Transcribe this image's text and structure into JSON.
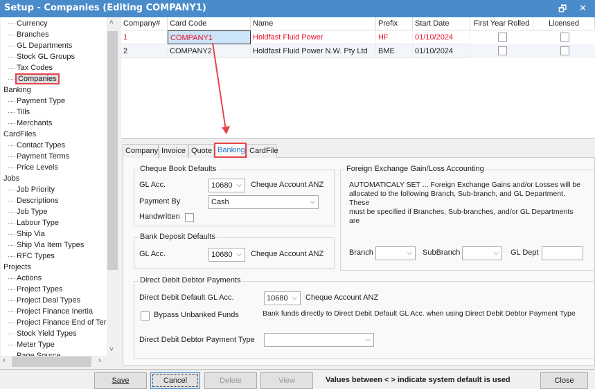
{
  "window": {
    "title": "Setup - Companies (Editing COMPANY1)",
    "restore_icon": "restore-icon",
    "close_icon": "close-icon"
  },
  "tree": [
    {
      "label": "Currency",
      "level": 1
    },
    {
      "label": "Branches",
      "level": 1
    },
    {
      "label": "GL Departments",
      "level": 1
    },
    {
      "label": "Stock GL Groups",
      "level": 1
    },
    {
      "label": "Tax Codes",
      "level": 1
    },
    {
      "label": "Companies",
      "level": 1,
      "selected": true
    },
    {
      "label": "Banking",
      "level": 0
    },
    {
      "label": "Payment Type",
      "level": 1
    },
    {
      "label": "Tills",
      "level": 1
    },
    {
      "label": "Merchants",
      "level": 1
    },
    {
      "label": "CardFiles",
      "level": 0
    },
    {
      "label": "Contact Types",
      "level": 1
    },
    {
      "label": "Payment Terms",
      "level": 1
    },
    {
      "label": "Price Levels",
      "level": 1
    },
    {
      "label": "Jobs",
      "level": 0
    },
    {
      "label": "Job Priority",
      "level": 1
    },
    {
      "label": "Descriptions",
      "level": 1
    },
    {
      "label": "Job Type",
      "level": 1
    },
    {
      "label": "Labour Type",
      "level": 1
    },
    {
      "label": "Ship Via",
      "level": 1
    },
    {
      "label": "Ship Via Item Types",
      "level": 1
    },
    {
      "label": "RFC Types",
      "level": 1
    },
    {
      "label": "Projects",
      "level": 0
    },
    {
      "label": "Actions",
      "level": 1
    },
    {
      "label": "Project Types",
      "level": 1
    },
    {
      "label": "Project Deal Types",
      "level": 1
    },
    {
      "label": "Project Finance Inertia",
      "level": 1
    },
    {
      "label": "Project Finance End of Term",
      "level": 1
    },
    {
      "label": "Stock Yield Types",
      "level": 1
    },
    {
      "label": "Meter Type",
      "level": 1
    },
    {
      "label": "Page Source",
      "level": 1
    }
  ],
  "grid": {
    "columns": [
      "Company#",
      "Card Code",
      "Name",
      "Prefix",
      "Start Date",
      "First Year Rolled",
      "Licensed"
    ],
    "rows": [
      {
        "num": "1",
        "code": "COMPANY1",
        "name": "Holdfast Fluid Power",
        "prefix": "HF",
        "start": "01/10/2024",
        "first_year_rolled": false,
        "licensed": false,
        "highlight": true
      },
      {
        "num": "2",
        "code": "COMPANY2",
        "name": "Holdfast Fluid Power N.W. Pty Ltd",
        "prefix": "BME",
        "start": "01/10/2024",
        "first_year_rolled": false,
        "licensed": false
      }
    ]
  },
  "tabs": [
    "Company",
    "Invoice",
    "Quote",
    "Banking",
    "CardFile"
  ],
  "active_tab": "Banking",
  "banking": {
    "cheque": {
      "title": "Cheque Book Defaults",
      "gl_label": "GL Acc.",
      "gl_value": "10680",
      "gl_desc": "Cheque Account ANZ",
      "payment_label": "Payment By",
      "payment_value": "Cash",
      "handwritten_label": "Handwritten",
      "handwritten": false
    },
    "deposit": {
      "title": "Bank Deposit Defaults",
      "gl_label": "GL Acc.",
      "gl_value": "10680",
      "gl_desc": "Cheque Account ANZ"
    },
    "fx": {
      "title": "Foreign Exchange Gain/Loss Accounting",
      "text1": "AUTOMATICALY SET ... Foreign Exchange Gains and/or Losses will be",
      "text2": "allocated to the following Branch, Sub-branch, and GL Department.  These",
      "text3": "must be specified if Branches, Sub-branches, and/or GL Departments are",
      "branch_label": "Branch",
      "subbranch_label": "SubBranch",
      "gldept_label": "GL Dept"
    },
    "dd": {
      "title": "Direct Debit Debtor Payments",
      "gl_label": "Direct Debit Default GL Acc.",
      "gl_value": "10680",
      "gl_desc": "Cheque Account ANZ",
      "bypass_label": "Bypass Unbanked Funds",
      "bypass": false,
      "bypass_desc": "Bank funds directly to Direct Debit Default GL Acc. when using Direct Debit Debtor Payment Type",
      "ptype_label": "Direct Debit Debtor Payment Type",
      "ptype_value": ""
    }
  },
  "footer": {
    "save": "Save",
    "cancel": "Cancel",
    "delete": "Delete",
    "view": "View",
    "note": "Values between < > indicate system default is used",
    "close": "Close"
  },
  "colors": {
    "title_bar": "#4a8ccb",
    "highlight_text": "#e8102a",
    "annotation": "#e8434b",
    "active_tab": "#1a73c8"
  }
}
